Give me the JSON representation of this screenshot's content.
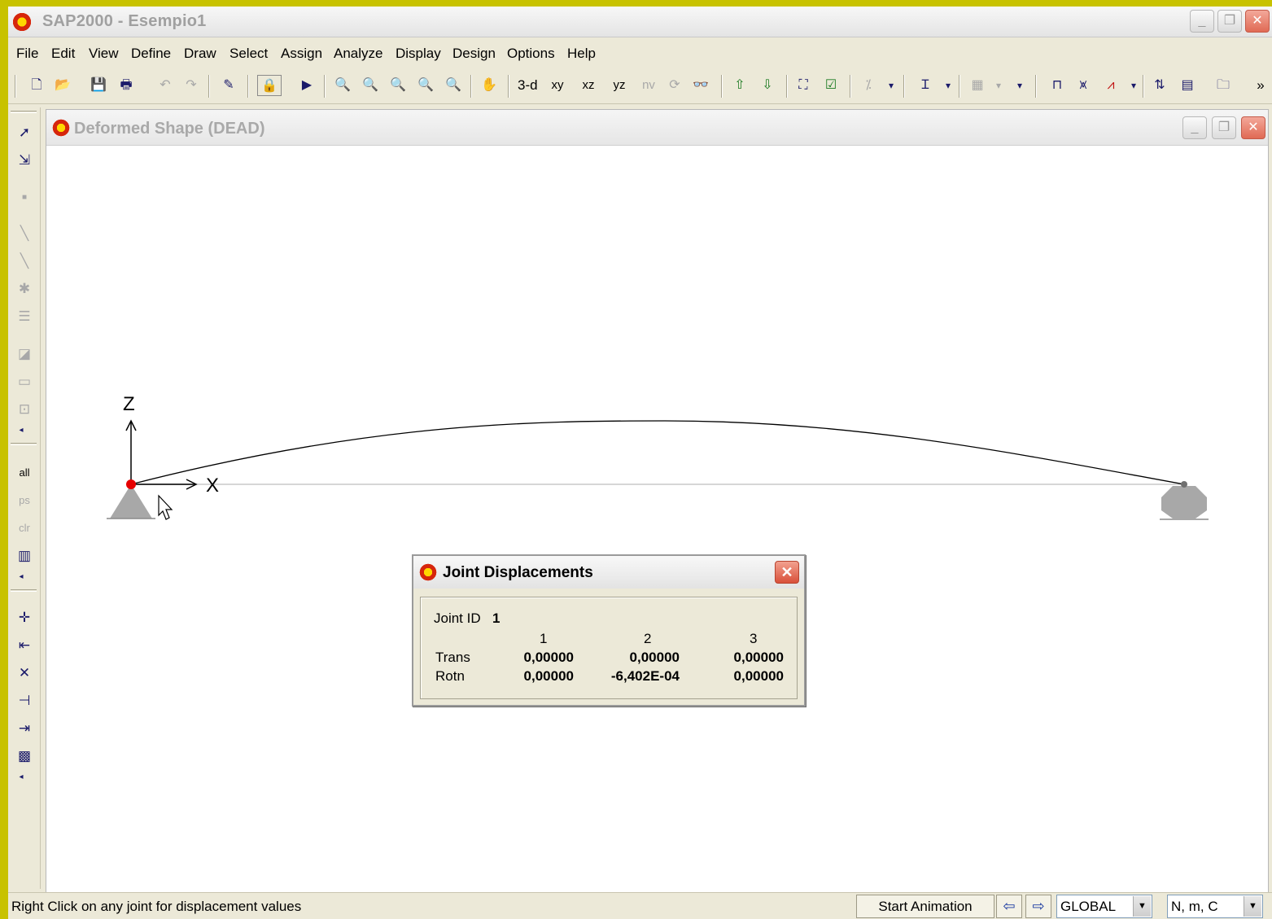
{
  "app": {
    "title": "SAP2000 - Esempio1"
  },
  "window_controls": {
    "minimize": "_",
    "restore": "❐",
    "close": "✕"
  },
  "menu": [
    "File",
    "Edit",
    "View",
    "Define",
    "Draw",
    "Select",
    "Assign",
    "Analyze",
    "Display",
    "Design",
    "Options",
    "Help"
  ],
  "toolbar": {
    "view_3d": "3-d",
    "view_xy": "xy",
    "view_xz": "xz",
    "view_yz": "yz",
    "view_nv": "nv",
    "overflow": "»"
  },
  "left_toolbar": {
    "select_all": "all",
    "previous_select": "ps",
    "clear_select": "clr"
  },
  "child_window": {
    "title": "Deformed Shape (DEAD)"
  },
  "canvas": {
    "axis_z": "Z",
    "axis_x": "X"
  },
  "dialog": {
    "title": "Joint Displacements",
    "joint_label": "Joint ID",
    "joint_id": "1",
    "columns": [
      "1",
      "2",
      "3"
    ],
    "rows": [
      {
        "label": "Trans",
        "values": [
          "0,00000",
          "0,00000",
          "0,00000"
        ]
      },
      {
        "label": "Rotn",
        "values": [
          "0,00000",
          "-6,402E-04",
          "0,00000"
        ]
      }
    ]
  },
  "status": {
    "message": "Right Click on any joint for displacement values",
    "animation_button": "Start Animation",
    "coord_system": "GLOBAL",
    "units": "N, m, C"
  },
  "colors": {
    "joint_selected": "#e60000",
    "support": "#a8a8a8",
    "close_button": "#e06a54"
  }
}
